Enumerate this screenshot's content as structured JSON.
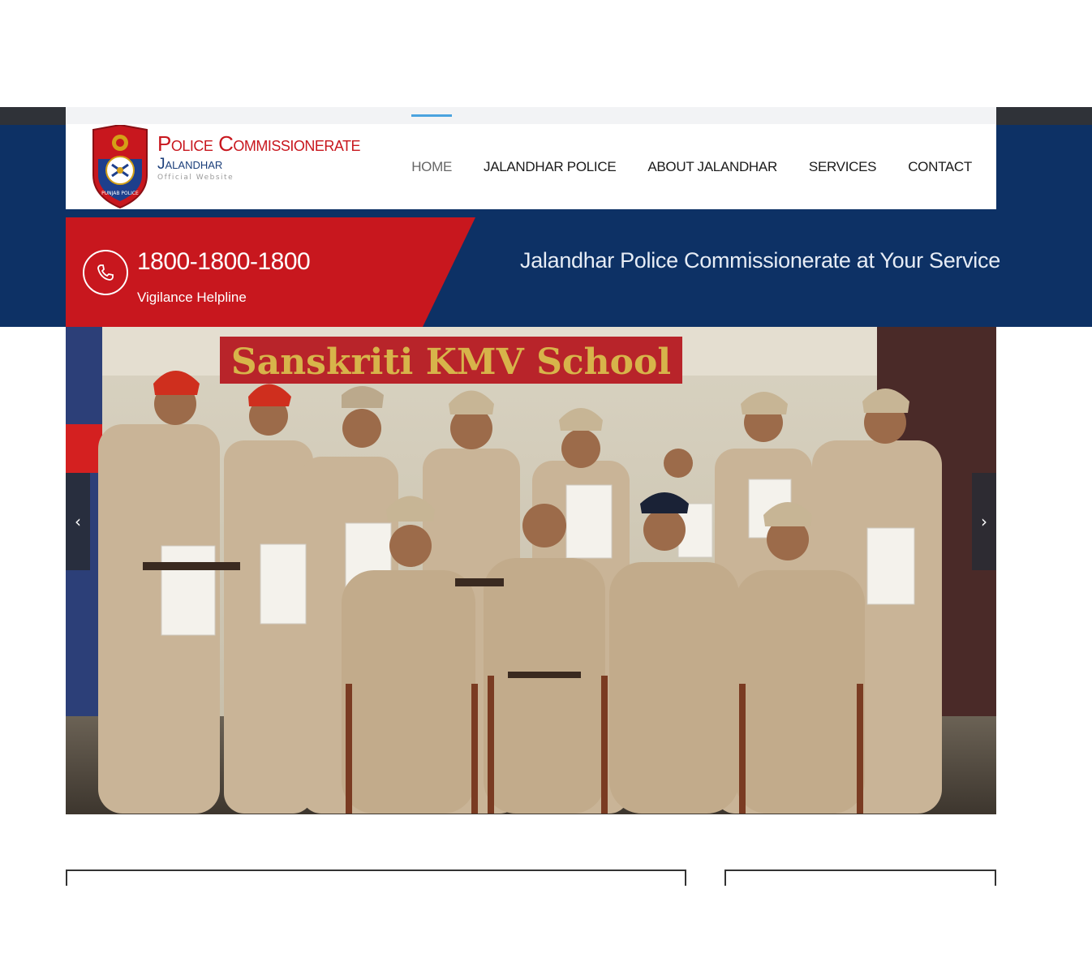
{
  "header": {
    "brand_title": "Police Commissionerate",
    "brand_subtitle": "Jalandhar",
    "brand_tagline": "Official Website",
    "logo_text": "PUNJAB POLICE",
    "nav": [
      {
        "label": "HOME",
        "active": true
      },
      {
        "label": "JALANDHAR POLICE",
        "active": false
      },
      {
        "label": "ABOUT JALANDHAR",
        "active": false
      },
      {
        "label": "SERVICES",
        "active": false
      },
      {
        "label": "CONTACT",
        "active": false
      }
    ]
  },
  "banner": {
    "phone_number": "1800-1800-1800",
    "helpline_label": "Vigilance Helpline",
    "tagline": "Jalandhar Police Commissionerate at Your Service"
  },
  "slider": {
    "prev_label": "‹",
    "next_label": "›",
    "photo_banner_text": "Sanskriti KMV School"
  },
  "colors": {
    "brand_red": "#c8171e",
    "navy": "#0d3165",
    "dark_strip": "#2f3238",
    "active_indicator": "#4aa3df"
  }
}
